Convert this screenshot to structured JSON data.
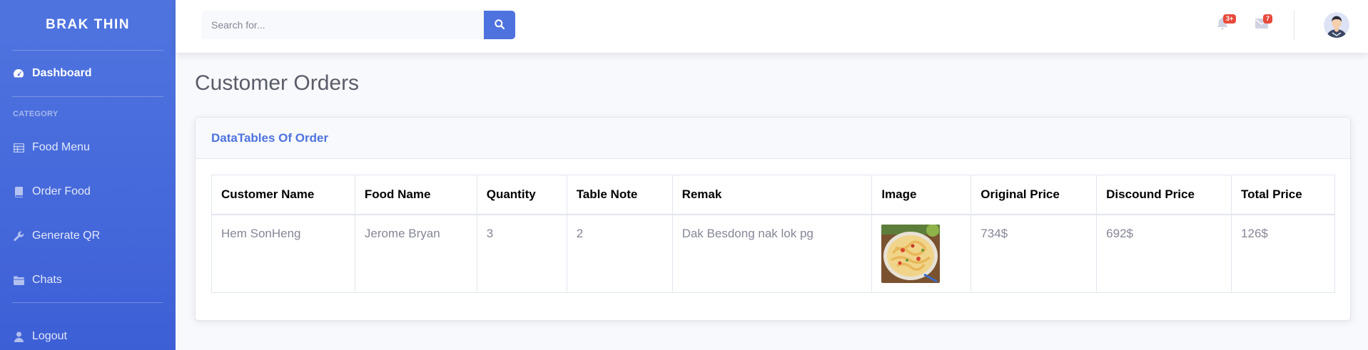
{
  "sidebar": {
    "brand": "BRAK THIN",
    "dashboard": "Dashboard",
    "category_heading": "CATEGORY",
    "items": [
      {
        "label": "Food Menu",
        "icon": "table-icon"
      },
      {
        "label": "Order Food",
        "icon": "book-icon"
      },
      {
        "label": "Generate QR",
        "icon": "wrench-icon"
      },
      {
        "label": "Chats",
        "icon": "folder-icon"
      }
    ],
    "logout": "Logout"
  },
  "topbar": {
    "search_placeholder": "Search for...",
    "alerts_badge": "3+",
    "messages_badge": "7"
  },
  "page": {
    "title": "Customer Orders"
  },
  "card": {
    "title": "DataTables Of Order"
  },
  "table": {
    "headers": [
      "Customer Name",
      "Food Name",
      "Quantity",
      "Table Note",
      "Remak",
      "Image",
      "Original Price",
      "Discound Price",
      "Total Price"
    ],
    "rows": [
      {
        "customer_name": "Hem SonHeng",
        "food_name": "Jerome Bryan",
        "quantity": "3",
        "table_note": "2",
        "remak": "Dak Besdong nak lok pg",
        "image": "pasta-dish-image",
        "original_price": "734$",
        "discount_price": "692$",
        "total_price": "126$"
      }
    ]
  },
  "colors": {
    "primary": "#4e73df",
    "badge": "#e74a3b",
    "text_gray": "#858796"
  }
}
